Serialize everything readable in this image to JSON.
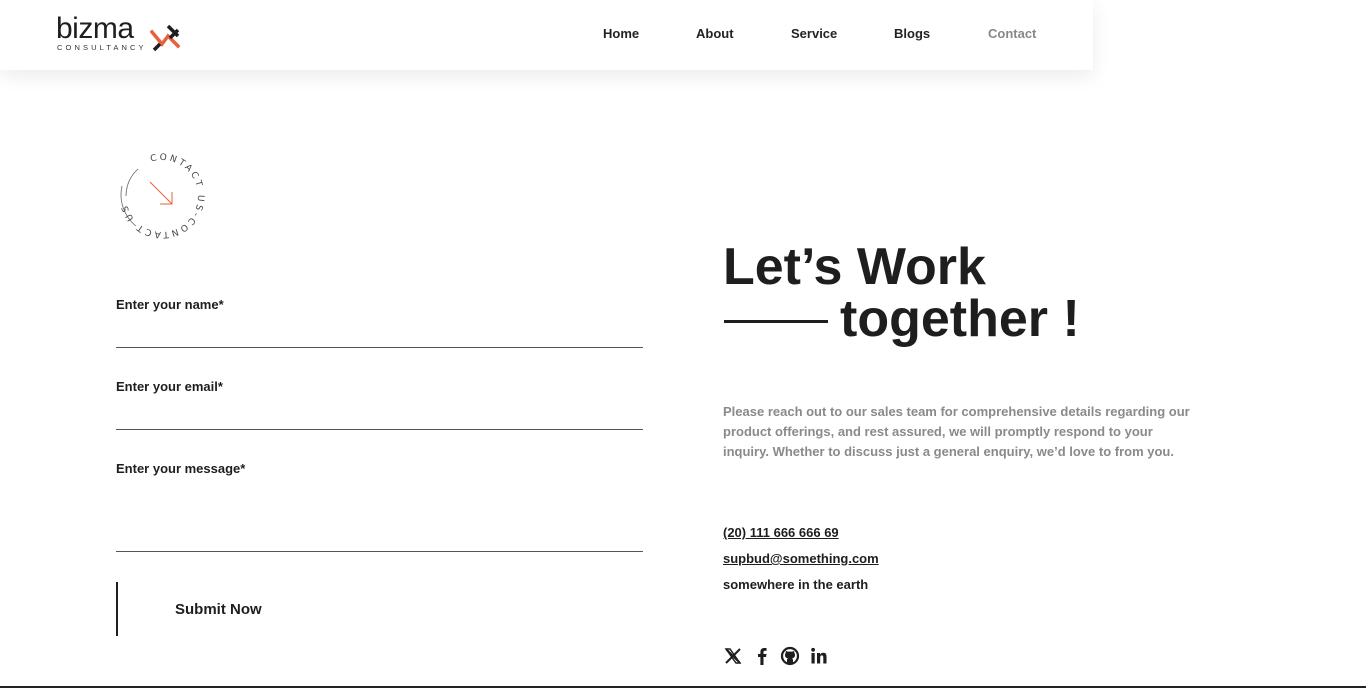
{
  "brand": {
    "name": "bizma",
    "tagline": "CONSULTANCY",
    "accent_color": "#e8603c",
    "icon": "logo-mark-icon"
  },
  "nav": {
    "items": [
      {
        "label": "Home"
      },
      {
        "label": "About"
      },
      {
        "label": "Service"
      },
      {
        "label": "Blogs"
      },
      {
        "label": "Contact",
        "active": true
      }
    ]
  },
  "badge": {
    "text": "CONTACT US-CONTACT US",
    "icon": "arrow-down-right-icon"
  },
  "form": {
    "name_label": "Enter your name*",
    "name_value": "",
    "email_label": "Enter your email*",
    "email_value": "",
    "message_label": "Enter your message*",
    "message_value": "",
    "submit_label": "Submit Now"
  },
  "headline": {
    "line1": "Let’s Work",
    "line2": "together !"
  },
  "description": "Please reach out to our sales team for comprehensive details regarding our product offerings, and rest assured, we will promptly respond to your inquiry. Whether to discuss just a general enquiry, we’d love to from you.",
  "contact": {
    "phone": "(20) 111 666 666 69",
    "email": "supbud@something.com",
    "address": "somewhere in the earth"
  },
  "social": [
    {
      "icon": "x-twitter-icon"
    },
    {
      "icon": "facebook-icon"
    },
    {
      "icon": "github-icon"
    },
    {
      "icon": "linkedin-icon"
    }
  ]
}
